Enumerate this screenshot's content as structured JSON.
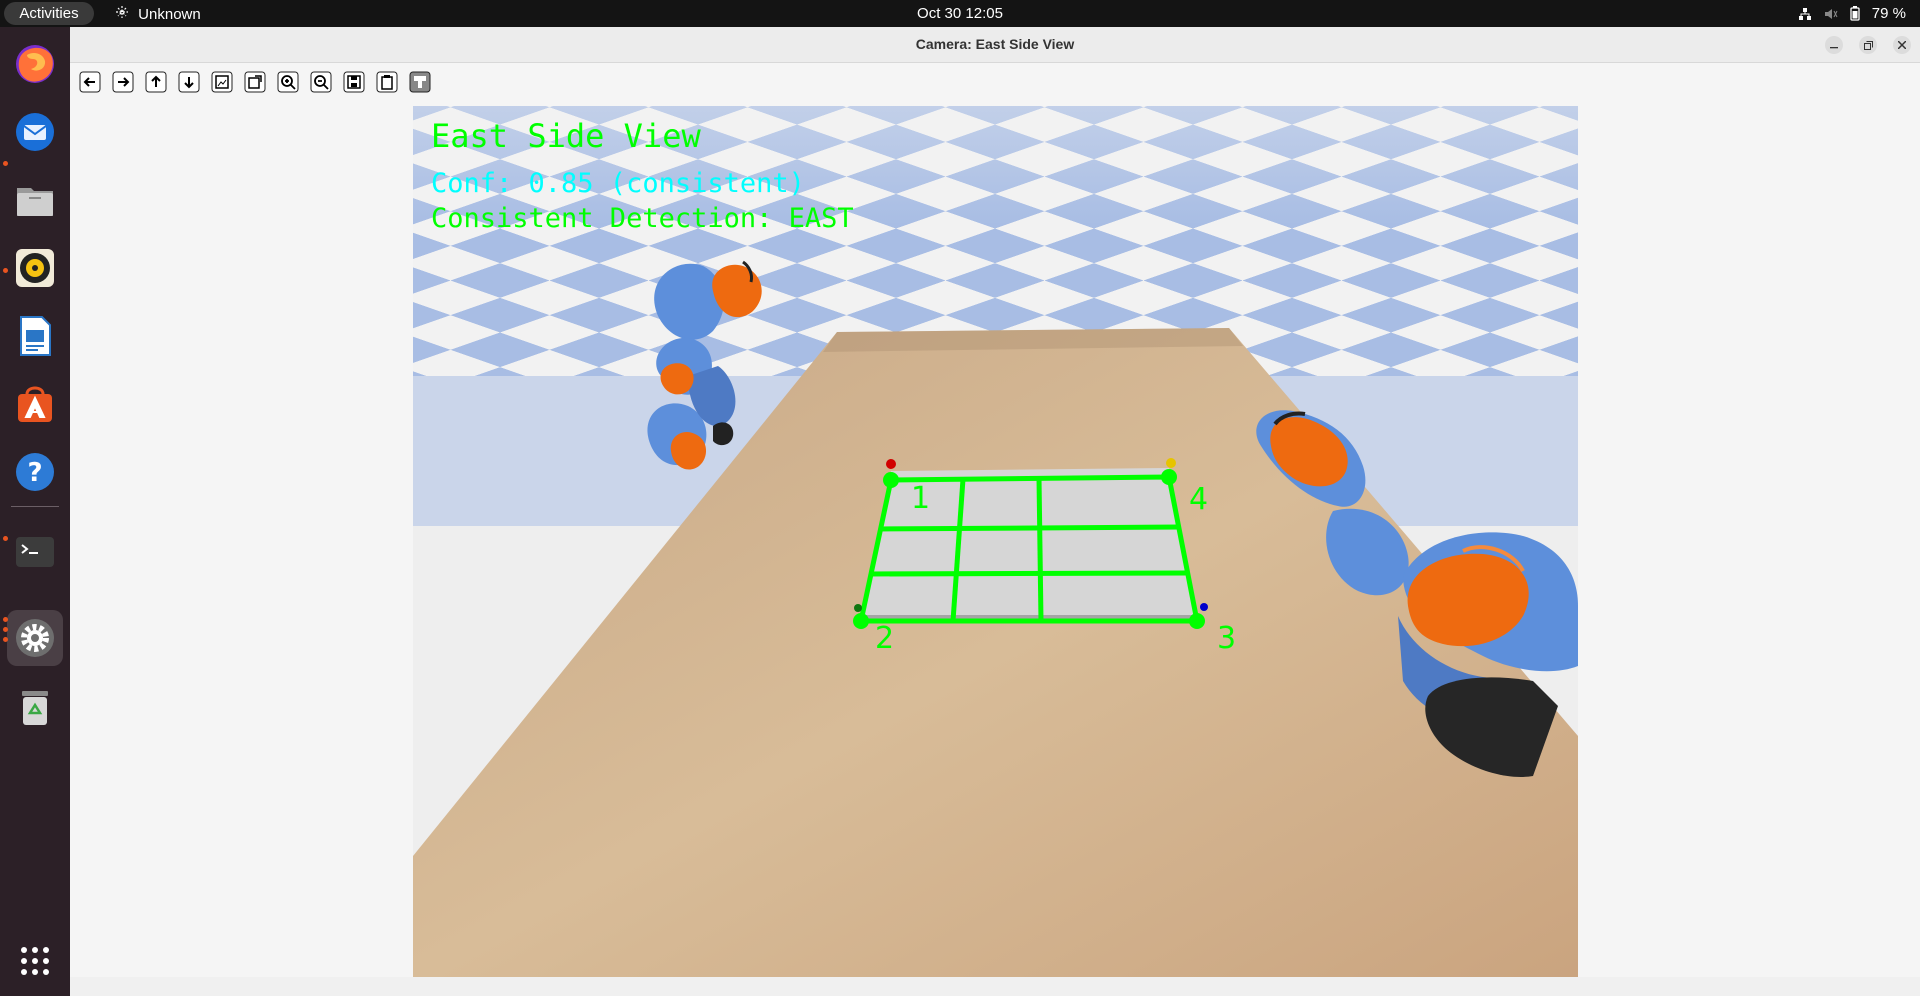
{
  "topbar": {
    "activities": "Activities",
    "network_label": "Unknown",
    "clock": "Oct 30  12:05",
    "battery": "79 %"
  },
  "dock": {
    "items": [
      {
        "name": "Firefox",
        "icon": "firefox-icon"
      },
      {
        "name": "Thunderbird",
        "icon": "thunderbird-icon"
      },
      {
        "name": "Files",
        "icon": "files-icon"
      },
      {
        "name": "Rhythmbox",
        "icon": "rhythmbox-icon"
      },
      {
        "name": "LibreOffice Writer",
        "icon": "writer-icon"
      },
      {
        "name": "Ubuntu Software",
        "icon": "software-icon"
      },
      {
        "name": "Help",
        "icon": "help-icon"
      },
      {
        "name": "Terminal",
        "icon": "terminal-icon"
      },
      {
        "name": "Settings",
        "icon": "settings-icon"
      },
      {
        "name": "Trash",
        "icon": "trash-icon"
      }
    ],
    "apps_grid_icon": "apps-grid-icon"
  },
  "window": {
    "title": "Camera: East Side View",
    "toolbar": [
      "back",
      "forward",
      "up",
      "down",
      "fit-window",
      "fit-image",
      "zoom-in",
      "zoom-out",
      "save",
      "copy-clipboard",
      "properties"
    ]
  },
  "overlay": {
    "view_label": "East Side View",
    "confidence": "Conf: 0.85 (consistent)",
    "detection": "Consistent Detection: EAST",
    "corner_1": "1",
    "corner_2": "2",
    "corner_3": "3",
    "corner_4": "4",
    "colors": {
      "green": "#00ff00",
      "cyan": "#00ffff"
    }
  }
}
